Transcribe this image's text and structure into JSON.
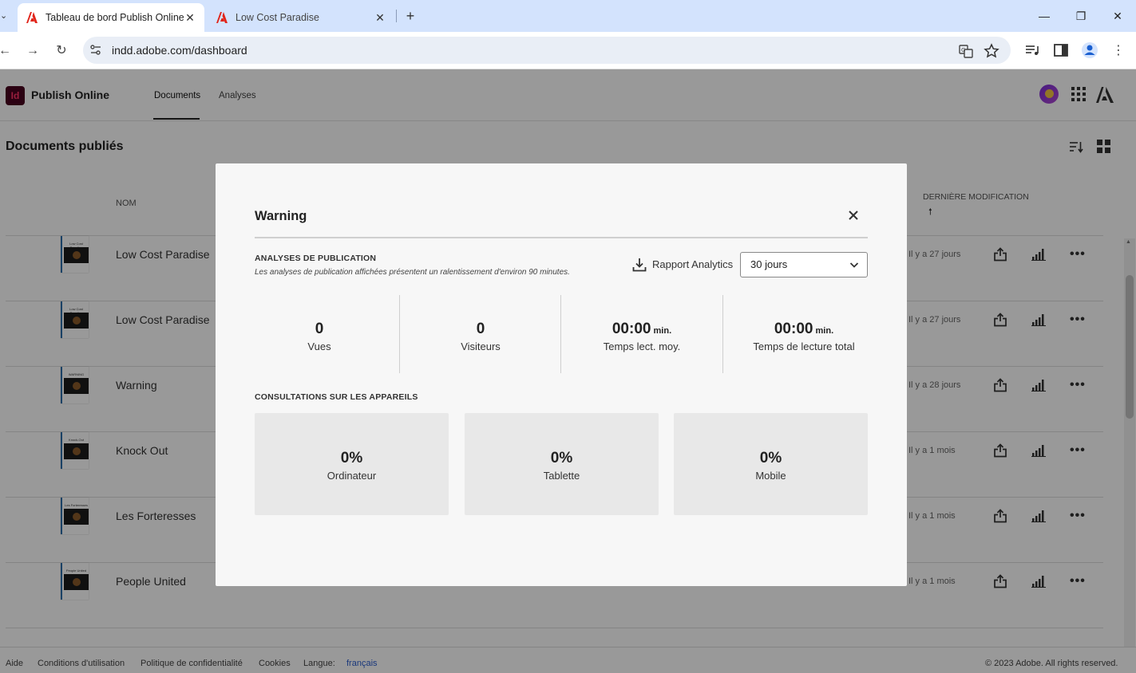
{
  "browser": {
    "tabs": [
      {
        "title": "Tableau de bord Publish Online",
        "active": true
      },
      {
        "title": "Low Cost Paradise",
        "active": false
      }
    ],
    "url": "indd.adobe.com/dashboard"
  },
  "app": {
    "product": "Publish Online",
    "nav": [
      "Documents",
      "Analyses"
    ],
    "section_title": "Documents publiés",
    "columns": {
      "name": "NOM",
      "modified": "DERNIÈRE MODIFICATION",
      "sort_arrow": "🠕"
    },
    "rows": [
      {
        "name": "Low Cost Paradise",
        "thumb_label": "Low Cost Paradise",
        "date": "Il y a 27 jours"
      },
      {
        "name": "Low Cost Paradise",
        "thumb_label": "Low Cost Paradise",
        "date": "Il y a 27 jours"
      },
      {
        "name": "Warning",
        "thumb_label": "WARNING",
        "date": "Il y a 28 jours"
      },
      {
        "name": "Knock Out",
        "thumb_label": "Knock-Out",
        "date": "Il y a 1 mois"
      },
      {
        "name": "Les Forteresses",
        "thumb_label": "Les Forteresses",
        "date": "Il y a 1 mois"
      },
      {
        "name": "People United",
        "thumb_label": "People United",
        "date": "Il y a 1 mois"
      }
    ],
    "footer": {
      "help": "Aide",
      "terms": "Conditions d'utilisation",
      "privacy": "Politique de confidentialité",
      "cookies": "Cookies",
      "language_label": "Langue:",
      "language": "français",
      "copyright": "© 2023 Adobe. All rights reserved."
    }
  },
  "modal": {
    "title": "Warning",
    "analytics_heading": "ANALYSES DE PUBLICATION",
    "analytics_note": "Les analyses de publication affichées présentent un ralentissement d'environ 90 minutes.",
    "report_label": "Rapport Analytics",
    "period_value": "30 jours",
    "stats": [
      {
        "value": "0",
        "unit": "",
        "label": "Vues"
      },
      {
        "value": "0",
        "unit": "",
        "label": "Visiteurs"
      },
      {
        "value": "00:00",
        "unit": " min.",
        "label": "Temps lect. moy."
      },
      {
        "value": "00:00",
        "unit": " min.",
        "label": "Temps de lecture total"
      }
    ],
    "devices_heading": "CONSULTATIONS SUR LES APPAREILS",
    "devices": [
      {
        "value": "0%",
        "label": "Ordinateur"
      },
      {
        "value": "0%",
        "label": "Tablette"
      },
      {
        "value": "0%",
        "label": "Mobile"
      }
    ]
  }
}
